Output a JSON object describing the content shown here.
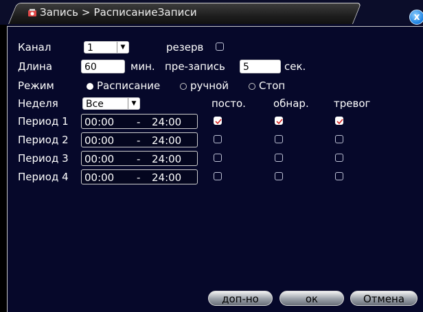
{
  "window": {
    "title": "Запись > РасписаниеЗаписи",
    "close_label": "x"
  },
  "form": {
    "channel_label": "Канал",
    "channel_value": "1",
    "reserve_label": "резерв",
    "reserve_checked": false,
    "length_label": "Длина",
    "length_value": "60",
    "length_unit": "мин.",
    "prerecord_label": "пре-запись",
    "prerecord_value": "5",
    "prerecord_unit": "сек.",
    "mode_label": "Режим",
    "mode_options": [
      "Расписание",
      "ручной",
      "Стоп"
    ],
    "mode_selected": "Расписание",
    "week_label": "Неделя",
    "week_value": "Все",
    "columns": [
      "посто.",
      "обнар.",
      "тревог"
    ]
  },
  "periods": [
    {
      "label": "Период 1",
      "start": "00:00",
      "dash": "-",
      "end": "24:00",
      "checks": [
        true,
        true,
        true
      ]
    },
    {
      "label": "Период 2",
      "start": "00:00",
      "dash": "-",
      "end": "24:00",
      "checks": [
        false,
        false,
        false
      ]
    },
    {
      "label": "Период 3",
      "start": "00:00",
      "dash": "-",
      "end": "24:00",
      "checks": [
        false,
        false,
        false
      ]
    },
    {
      "label": "Период 4",
      "start": "00:00",
      "dash": "-",
      "end": "24:00",
      "checks": [
        false,
        false,
        false
      ]
    }
  ],
  "buttons": {
    "advanced": "доп-но",
    "ok": "ок",
    "cancel": "Отмена"
  },
  "colors": {
    "background": "#06082a",
    "check_mark": "#d42020"
  }
}
